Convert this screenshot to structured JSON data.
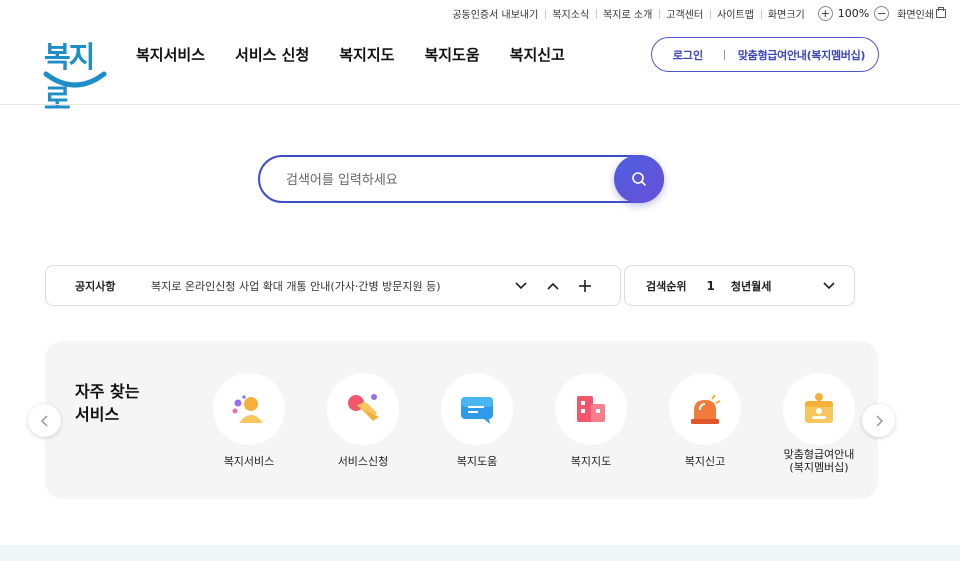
{
  "utility": {
    "links": [
      "공동인증서 내보내기",
      "복지소식",
      "복지로 소개",
      "고객센터",
      "사이트맵"
    ],
    "zoom_label": "화면크기",
    "zoom_in": "+",
    "zoom_value": "100%",
    "zoom_out": "−",
    "print_label": "화면인쇄"
  },
  "header": {
    "logo_text": "복지로",
    "nav": [
      "복지서비스",
      "서비스 신청",
      "복지지도",
      "복지도움",
      "복지신고"
    ],
    "login": "로그인",
    "guide": "맞춤형급여안내(복지멤버십)"
  },
  "search": {
    "placeholder": "검색어를 입력하세요",
    "icon": "search-icon"
  },
  "notice": {
    "label": "공지사항",
    "text": "복지로 온라인신청 사업 확대 개통 안내(가사·간병 방문지원 등)"
  },
  "ranking": {
    "label": "검색순위",
    "rank": "1",
    "term": "청년월세"
  },
  "frequent": {
    "title": "자주 찾는 서비스",
    "items": [
      {
        "label": "복지서비스",
        "icon": "people-icon"
      },
      {
        "label": "서비스신청",
        "icon": "hand-tap-icon"
      },
      {
        "label": "복지도움",
        "icon": "chat-bubble-icon"
      },
      {
        "label": "복지지도",
        "icon": "building-map-icon"
      },
      {
        "label": "복지신고",
        "icon": "siren-icon"
      },
      {
        "label": "맞춤형급여안내\n(복지멤버십)",
        "icon": "membership-card-icon"
      }
    ]
  },
  "colors": {
    "brand_blue": "#3d4fc7",
    "logo_blue": "#1d8ec7",
    "panel_bg": "#f5f5f5"
  }
}
